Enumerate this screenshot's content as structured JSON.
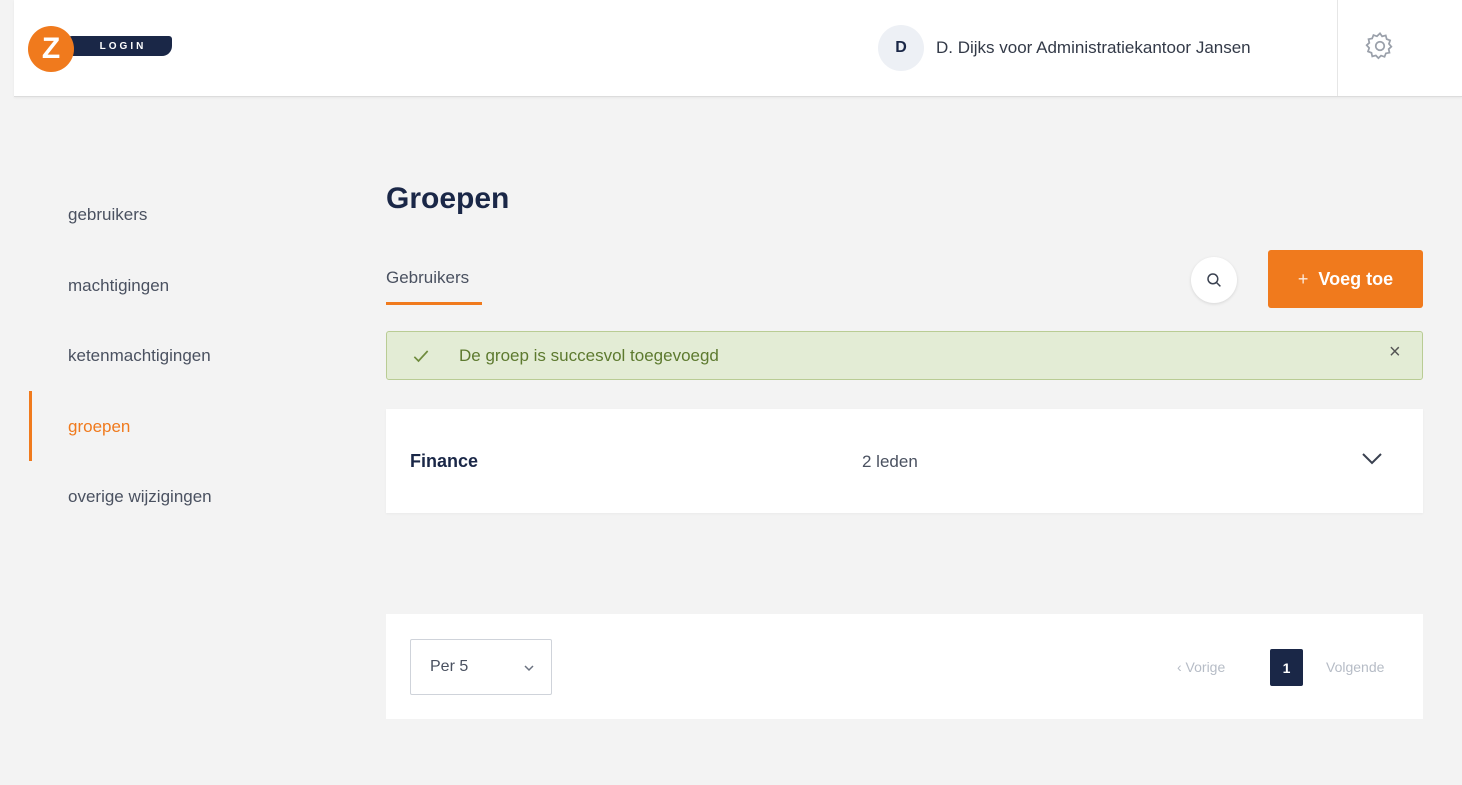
{
  "header": {
    "logo_letter": "Z",
    "logo_text": "LOGIN",
    "user_initial": "D",
    "user_name": "D. Dijks voor Administratiekantoor Jansen"
  },
  "sidebar": {
    "items": [
      {
        "label": "gebruikers",
        "active": false
      },
      {
        "label": "machtigingen",
        "active": false
      },
      {
        "label": "ketenmachtigingen",
        "active": false
      },
      {
        "label": "groepen",
        "active": true
      },
      {
        "label": "overige wijzigingen",
        "active": false
      }
    ]
  },
  "main": {
    "title": "Groepen",
    "tab_label": "Gebruikers",
    "add_button": {
      "icon": "+",
      "label": "Voeg toe"
    },
    "alert": {
      "message": "De groep is succesvol toegevoegd",
      "close": "×"
    },
    "groups": [
      {
        "name": "Finance",
        "members": "2 leden"
      }
    ],
    "pagination": {
      "per_page": "Per 5",
      "previous": "‹  Vorige",
      "current_page": "1",
      "next": "Volgende"
    }
  },
  "colors": {
    "accent": "#f07a1d",
    "navy": "#1a2747",
    "success_bg": "#e3ecd5",
    "success_text": "#5d7a2f"
  }
}
